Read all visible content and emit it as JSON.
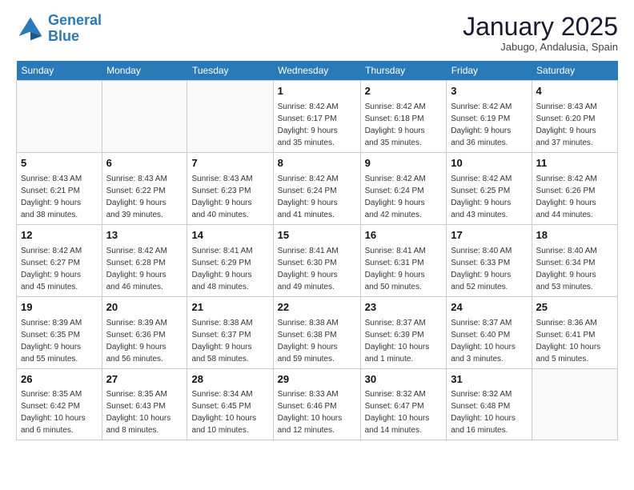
{
  "header": {
    "logo_general": "General",
    "logo_blue": "Blue",
    "month_title": "January 2025",
    "subtitle": "Jabugo, Andalusia, Spain"
  },
  "weekdays": [
    "Sunday",
    "Monday",
    "Tuesday",
    "Wednesday",
    "Thursday",
    "Friday",
    "Saturday"
  ],
  "weeks": [
    [
      {
        "day": "",
        "info": ""
      },
      {
        "day": "",
        "info": ""
      },
      {
        "day": "",
        "info": ""
      },
      {
        "day": "1",
        "info": "Sunrise: 8:42 AM\nSunset: 6:17 PM\nDaylight: 9 hours\nand 35 minutes."
      },
      {
        "day": "2",
        "info": "Sunrise: 8:42 AM\nSunset: 6:18 PM\nDaylight: 9 hours\nand 35 minutes."
      },
      {
        "day": "3",
        "info": "Sunrise: 8:42 AM\nSunset: 6:19 PM\nDaylight: 9 hours\nand 36 minutes."
      },
      {
        "day": "4",
        "info": "Sunrise: 8:43 AM\nSunset: 6:20 PM\nDaylight: 9 hours\nand 37 minutes."
      }
    ],
    [
      {
        "day": "5",
        "info": "Sunrise: 8:43 AM\nSunset: 6:21 PM\nDaylight: 9 hours\nand 38 minutes."
      },
      {
        "day": "6",
        "info": "Sunrise: 8:43 AM\nSunset: 6:22 PM\nDaylight: 9 hours\nand 39 minutes."
      },
      {
        "day": "7",
        "info": "Sunrise: 8:43 AM\nSunset: 6:23 PM\nDaylight: 9 hours\nand 40 minutes."
      },
      {
        "day": "8",
        "info": "Sunrise: 8:42 AM\nSunset: 6:24 PM\nDaylight: 9 hours\nand 41 minutes."
      },
      {
        "day": "9",
        "info": "Sunrise: 8:42 AM\nSunset: 6:24 PM\nDaylight: 9 hours\nand 42 minutes."
      },
      {
        "day": "10",
        "info": "Sunrise: 8:42 AM\nSunset: 6:25 PM\nDaylight: 9 hours\nand 43 minutes."
      },
      {
        "day": "11",
        "info": "Sunrise: 8:42 AM\nSunset: 6:26 PM\nDaylight: 9 hours\nand 44 minutes."
      }
    ],
    [
      {
        "day": "12",
        "info": "Sunrise: 8:42 AM\nSunset: 6:27 PM\nDaylight: 9 hours\nand 45 minutes."
      },
      {
        "day": "13",
        "info": "Sunrise: 8:42 AM\nSunset: 6:28 PM\nDaylight: 9 hours\nand 46 minutes."
      },
      {
        "day": "14",
        "info": "Sunrise: 8:41 AM\nSunset: 6:29 PM\nDaylight: 9 hours\nand 48 minutes."
      },
      {
        "day": "15",
        "info": "Sunrise: 8:41 AM\nSunset: 6:30 PM\nDaylight: 9 hours\nand 49 minutes."
      },
      {
        "day": "16",
        "info": "Sunrise: 8:41 AM\nSunset: 6:31 PM\nDaylight: 9 hours\nand 50 minutes."
      },
      {
        "day": "17",
        "info": "Sunrise: 8:40 AM\nSunset: 6:33 PM\nDaylight: 9 hours\nand 52 minutes."
      },
      {
        "day": "18",
        "info": "Sunrise: 8:40 AM\nSunset: 6:34 PM\nDaylight: 9 hours\nand 53 minutes."
      }
    ],
    [
      {
        "day": "19",
        "info": "Sunrise: 8:39 AM\nSunset: 6:35 PM\nDaylight: 9 hours\nand 55 minutes."
      },
      {
        "day": "20",
        "info": "Sunrise: 8:39 AM\nSunset: 6:36 PM\nDaylight: 9 hours\nand 56 minutes."
      },
      {
        "day": "21",
        "info": "Sunrise: 8:38 AM\nSunset: 6:37 PM\nDaylight: 9 hours\nand 58 minutes."
      },
      {
        "day": "22",
        "info": "Sunrise: 8:38 AM\nSunset: 6:38 PM\nDaylight: 9 hours\nand 59 minutes."
      },
      {
        "day": "23",
        "info": "Sunrise: 8:37 AM\nSunset: 6:39 PM\nDaylight: 10 hours\nand 1 minute."
      },
      {
        "day": "24",
        "info": "Sunrise: 8:37 AM\nSunset: 6:40 PM\nDaylight: 10 hours\nand 3 minutes."
      },
      {
        "day": "25",
        "info": "Sunrise: 8:36 AM\nSunset: 6:41 PM\nDaylight: 10 hours\nand 5 minutes."
      }
    ],
    [
      {
        "day": "26",
        "info": "Sunrise: 8:35 AM\nSunset: 6:42 PM\nDaylight: 10 hours\nand 6 minutes."
      },
      {
        "day": "27",
        "info": "Sunrise: 8:35 AM\nSunset: 6:43 PM\nDaylight: 10 hours\nand 8 minutes."
      },
      {
        "day": "28",
        "info": "Sunrise: 8:34 AM\nSunset: 6:45 PM\nDaylight: 10 hours\nand 10 minutes."
      },
      {
        "day": "29",
        "info": "Sunrise: 8:33 AM\nSunset: 6:46 PM\nDaylight: 10 hours\nand 12 minutes."
      },
      {
        "day": "30",
        "info": "Sunrise: 8:32 AM\nSunset: 6:47 PM\nDaylight: 10 hours\nand 14 minutes."
      },
      {
        "day": "31",
        "info": "Sunrise: 8:32 AM\nSunset: 6:48 PM\nDaylight: 10 hours\nand 16 minutes."
      },
      {
        "day": "",
        "info": ""
      }
    ]
  ]
}
